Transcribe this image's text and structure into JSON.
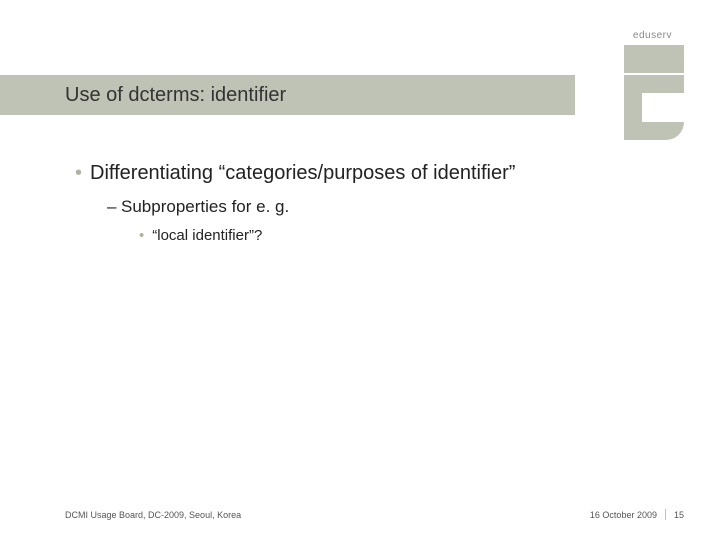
{
  "brand": "eduserv",
  "title": "Use of dcterms: identifier",
  "bullets": {
    "l1": "Differentiating “categories/purposes of identifier”",
    "l2": "Subproperties for e. g.",
    "l3": "“local identifier”?"
  },
  "footer": {
    "left": "DCMI Usage Board, DC-2009, Seoul, Korea",
    "date": "16 October 2009",
    "page": "15"
  }
}
